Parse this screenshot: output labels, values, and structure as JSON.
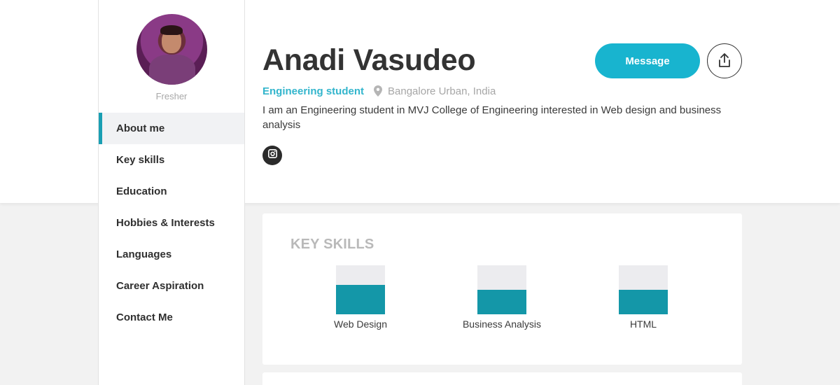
{
  "profile": {
    "name": "Anadi Vasudeo",
    "status_label": "Fresher",
    "role": "Engineering student",
    "location": "Bangalore Urban, India",
    "bio": "I am an Engineering student in MVJ College of Engineering interested in Web design and business analysis"
  },
  "sidebar": {
    "items": [
      {
        "label": "About me",
        "active": true
      },
      {
        "label": "Key skills",
        "active": false
      },
      {
        "label": "Education",
        "active": false
      },
      {
        "label": "Hobbies & Interests",
        "active": false
      },
      {
        "label": "Languages",
        "active": false
      },
      {
        "label": "Career Aspiration",
        "active": false
      },
      {
        "label": "Contact Me",
        "active": false
      }
    ]
  },
  "actions": {
    "message_label": "Message",
    "share_icon": "share-icon"
  },
  "social": {
    "icon": "instagram-icon"
  },
  "key_skills": {
    "title": "KEY SKILLS",
    "skills": [
      {
        "label": "Web Design",
        "level": 0.6
      },
      {
        "label": "Business Analysis",
        "level": 0.5
      },
      {
        "label": "HTML",
        "level": 0.5
      }
    ]
  },
  "colors": {
    "accent": "#18b4cf",
    "skill_fill": "#1497a8",
    "active_nav_border": "#1a9fb3"
  }
}
